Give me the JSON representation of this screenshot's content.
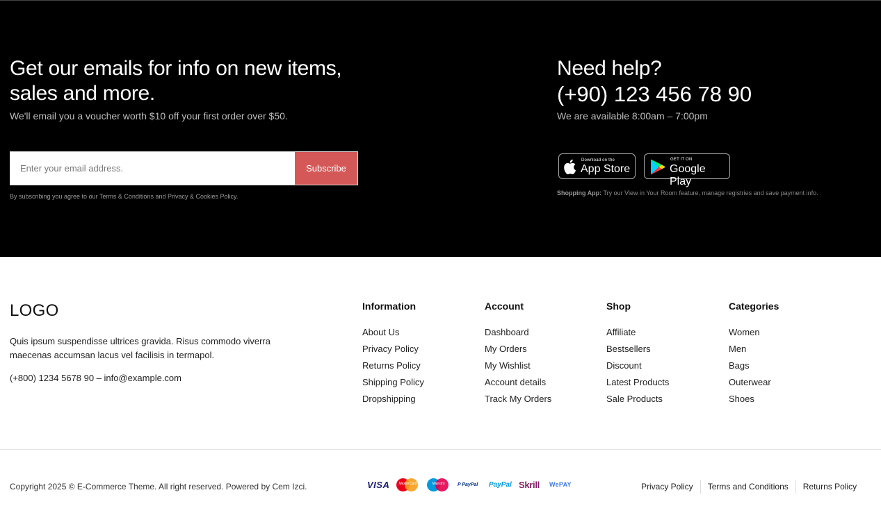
{
  "newsletter": {
    "title": "Get our emails for info on new items, sales and more.",
    "subtitle": "We'll email you a voucher worth $10 off your first order over $50.",
    "email_placeholder": "Enter your email address.",
    "subscribe_label": "Subscribe",
    "terms_text": "By subscribing you agree to our Terms & Conditions and Privacy & Cookies Policy."
  },
  "help": {
    "title": "Need help?",
    "phone": "(+90) 123 456 78 90",
    "hours": "We are available 8:00am – 7:00pm",
    "app_store": {
      "small": "Download on the",
      "big": "App Store",
      "icon": "apple-icon"
    },
    "google_play": {
      "small": "GET IT ON",
      "big": "Google Play",
      "icon": "google-play-icon"
    },
    "app_note_label": "Shopping App:",
    "app_note_text": " Try our View in Your Room feature, manage registries and save payment info."
  },
  "brand": {
    "logo": "LOGO",
    "about": "Quis ipsum suspendisse ultrices gravida. Risus commodo viverra maecenas accumsan lacus vel facilisis in termapol.",
    "contact": "(+800) 1234 5678 90 – info@example.com"
  },
  "columns": [
    {
      "title": "Information",
      "items": [
        "About Us",
        "Privacy Policy",
        "Returns Policy",
        "Shipping Policy",
        "Dropshipping"
      ]
    },
    {
      "title": "Account",
      "items": [
        "Dashboard",
        "My Orders",
        "My Wishlist",
        "Account details",
        "Track My Orders"
      ]
    },
    {
      "title": "Shop",
      "items": [
        "Affiliate",
        "Bestsellers",
        "Discount",
        "Latest Products",
        "Sale Products"
      ]
    },
    {
      "title": "Categories",
      "items": [
        "Women",
        "Men",
        "Bags",
        "Outerwear",
        "Shoes"
      ]
    }
  ],
  "bottom": {
    "copyright": "Copyright 2025 © E-Commerce Theme. All right reserved. Powered by Cem Izci.",
    "payments": {
      "visa": "VISA",
      "mastercard": "MasterCard",
      "maestro": "Maestro",
      "paypal_small": "P PayPal",
      "paypal": "PayPal",
      "skrill": "Skrill",
      "wepay": "WePAY"
    },
    "legal_links": [
      "Privacy Policy",
      "Terms and Conditions",
      "Returns Policy"
    ]
  },
  "colors": {
    "subscribe_button": "#d55858",
    "top_background": "#000000"
  }
}
